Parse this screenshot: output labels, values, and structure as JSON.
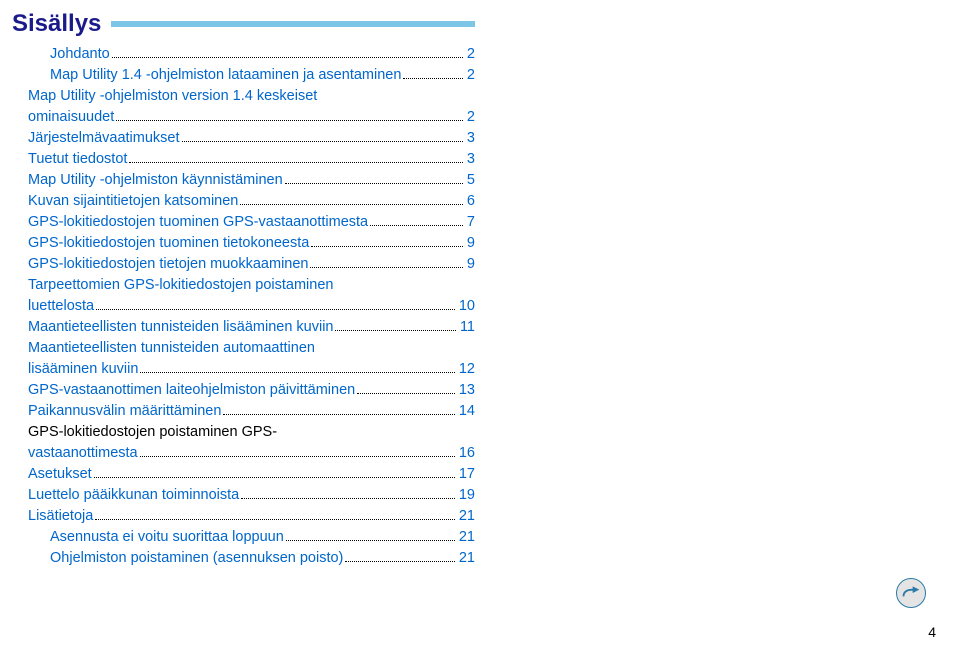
{
  "title": "Sisällys",
  "page_number": "4",
  "toc": [
    {
      "label": "Johdanto",
      "page": "2",
      "link": true,
      "sub": true
    },
    {
      "label": "Map Utility 1.4 -ohjelmiston lataaminen ja asentaminen",
      "page": "2",
      "link": true,
      "sub": true,
      "wrap_after": "ja asentaminen"
    },
    {
      "label": "Map Utility -ohjelmiston version 1.4 keskeiset",
      "label2": "ominaisuudet",
      "page": "2",
      "link": true,
      "sub": true,
      "multiline": true
    },
    {
      "label": "Järjestelmävaatimukset",
      "page": "3",
      "link": true
    },
    {
      "label": "Tuetut tiedostot",
      "page": "3",
      "link": true
    },
    {
      "label": "Map Utility -ohjelmiston käynnistäminen",
      "page": "5",
      "link": true
    },
    {
      "label": "Kuvan sijaintitietojen katsominen",
      "page": "6",
      "link": true
    },
    {
      "label": "GPS-lokitiedostojen tuominen GPS-vastaanottimesta",
      "page": "7",
      "link": true
    },
    {
      "label": "GPS-lokitiedostojen tuominen tietokoneesta",
      "page": "9",
      "link": true
    },
    {
      "label": "GPS-lokitiedostojen tietojen muokkaaminen",
      "page": "9",
      "link": true
    },
    {
      "label": "Tarpeettomien GPS-lokitiedostojen poistaminen",
      "label2": "luettelosta",
      "page": "10",
      "link": true,
      "multiline": true
    },
    {
      "label": "Maantieteellisten tunnisteiden lisääminen kuviin",
      "page": "11",
      "link": true
    },
    {
      "label": "Maantieteellisten tunnisteiden automaattinen",
      "label2": "lisääminen kuviin",
      "page": "12",
      "link": true,
      "multiline": true
    },
    {
      "label": "GPS-vastaanottimen laiteohjelmiston päivittäminen",
      "page": "13",
      "link": true
    },
    {
      "label": "Paikannusvälin määrittäminen",
      "page": "14",
      "link": true
    },
    {
      "label": "GPS-lokitiedostojen poistaminen GPS-",
      "label2": "vastaanottimesta",
      "page": "16",
      "link": true,
      "multiline": true,
      "black_first": true
    },
    {
      "label": "Asetukset",
      "page": "17",
      "link": true
    },
    {
      "label": "Luettelo pääikkunan toiminnoista",
      "page": "19",
      "link": true
    },
    {
      "label": "Lisätietoja",
      "page": "21",
      "link": true
    },
    {
      "label": "Asennusta ei voitu suorittaa loppuun",
      "page": "21",
      "link": true,
      "sub": true
    },
    {
      "label": "Ohjelmiston poistaminen (asennuksen poisto)",
      "page": "21",
      "link": true,
      "sub": true
    }
  ]
}
